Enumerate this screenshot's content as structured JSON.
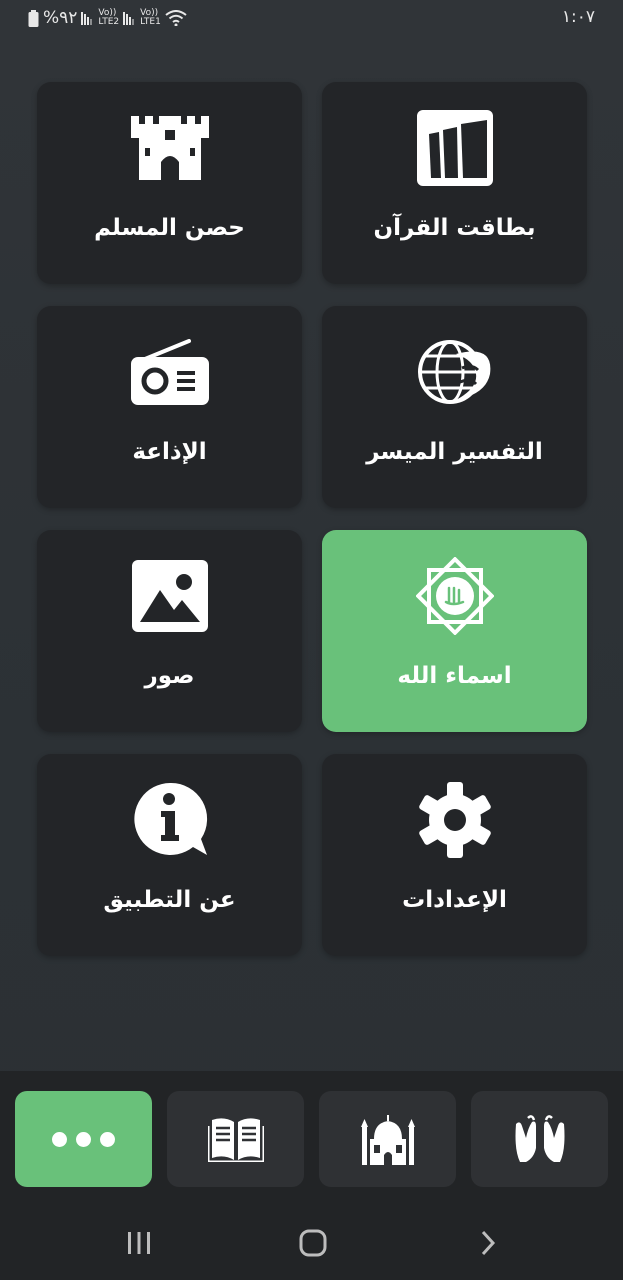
{
  "status_bar": {
    "battery": "%٩٢",
    "time": "١:٠٧",
    "sim2": "LTE2",
    "sim1": "LTE1",
    "volte": "Vo))"
  },
  "tiles": [
    {
      "label": "بطاقت القرآن",
      "icon": "quran-cards-icon",
      "active": false
    },
    {
      "label": "حصن المسلم",
      "icon": "fortress-icon",
      "active": false
    },
    {
      "label": "التفسير الميسر",
      "icon": "tafsir-globe-icon",
      "active": false
    },
    {
      "label": "الإذاعة",
      "icon": "radio-icon",
      "active": false
    },
    {
      "label": "اسماء الله",
      "icon": "allah-names-icon",
      "active": true
    },
    {
      "label": "صور",
      "icon": "image-icon",
      "active": false
    },
    {
      "label": "الإعدادات",
      "icon": "gear-icon",
      "active": false
    },
    {
      "label": "عن التطبيق",
      "icon": "info-icon",
      "active": false
    }
  ],
  "bottom_nav": [
    "more-dots-icon",
    "open-book-icon",
    "mosque-icon",
    "praying-hands-icon"
  ],
  "colors": {
    "accent": "#69c17a",
    "tile_bg": "#232528",
    "page_bg": "#2e3236",
    "nav_bg": "#222426"
  }
}
